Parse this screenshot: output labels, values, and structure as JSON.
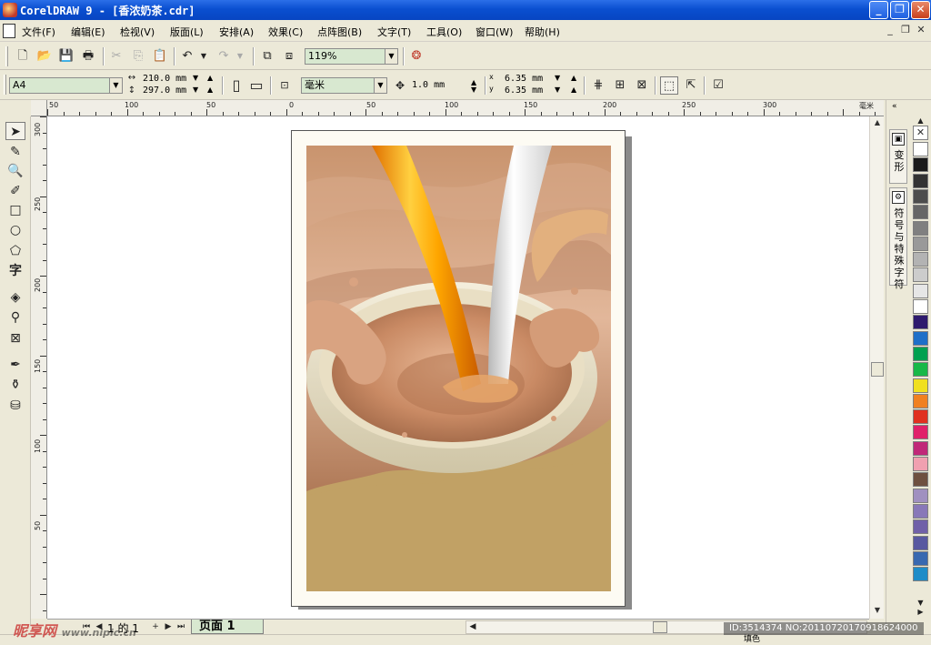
{
  "window": {
    "title": "CorelDRAW 9 - [香浓奶茶.cdr]",
    "minimize_glyph": "_",
    "maximize_glyph": "❐",
    "close_glyph": "✕"
  },
  "menu": {
    "items": [
      "文件(F)",
      "编辑(E)",
      "检视(V)",
      "版面(L)",
      "安排(A)",
      "效果(C)",
      "点阵图(B)",
      "文字(T)",
      "工具(O)",
      "窗口(W)",
      "帮助(H)"
    ],
    "mdi_controls": [
      "_",
      "❐",
      "✕"
    ]
  },
  "standard_toolbar": {
    "zoom_value": "119%",
    "icons": [
      "new-icon",
      "open-icon",
      "save-icon",
      "print-icon",
      "cut-icon",
      "copy-icon",
      "paste-icon",
      "undo-icon",
      "redo-icon",
      "import-icon",
      "export-icon",
      "corel-launcher-icon"
    ]
  },
  "property_bar": {
    "paper_size": "A4",
    "width": "210.0 mm",
    "height": "297.0 mm",
    "units": "毫米",
    "nudge": "1.0 mm",
    "dup_x": "6.35 mm",
    "dup_y": "6.35 mm",
    "dup_x_label": "x",
    "dup_y_label": "y"
  },
  "rulers": {
    "unit_label": "毫米",
    "top_ticks": [
      "50",
      "100",
      "50",
      "0",
      "50",
      "100",
      "150",
      "200",
      "250",
      "300"
    ],
    "left_ticks": [
      "300",
      "250",
      "200",
      "150",
      "100",
      "50"
    ]
  },
  "docker": {
    "tab1": "变形",
    "tab2": "符号与特殊字符"
  },
  "palette": {
    "colors": [
      "#FFFFFF",
      "#1A1A1A",
      "#333333",
      "#4D4D4D",
      "#666666",
      "#808080",
      "#999999",
      "#B3B3B3",
      "#CCCCCC",
      "#E6E6E6",
      "#FFFFFF",
      "#2E1A6E",
      "#1E6FC8",
      "#00A050",
      "#18B848",
      "#F0E020",
      "#F08020",
      "#E03020",
      "#E0206A",
      "#C02878",
      "#F0A0B0",
      "#6E5040",
      "#A090C0",
      "#8878B8",
      "#7060A8",
      "#5858A0",
      "#3868B0",
      "#1E8CC8"
    ]
  },
  "page_navigator": {
    "page_count_label": "1 的 1",
    "page_tab": "页面 1"
  },
  "statusbar": {
    "label": "填色"
  },
  "watermark": {
    "brand": "昵享网",
    "url": "www.nipic.cn",
    "image_id": "ID:3514374 NO:20110720170918624000"
  }
}
